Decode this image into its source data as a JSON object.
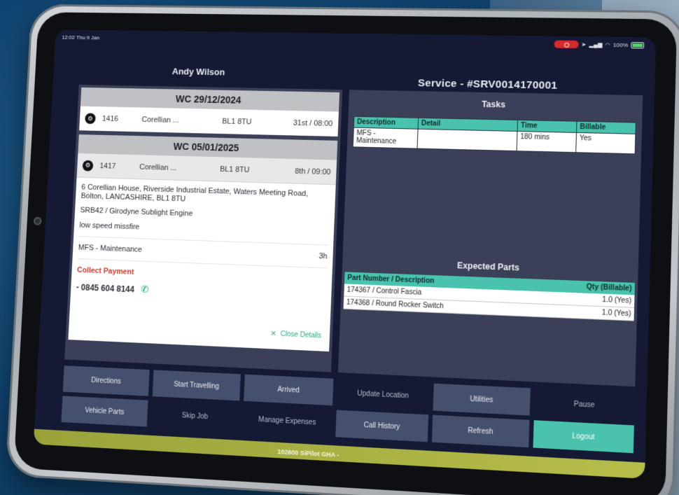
{
  "status_bar": {
    "time": "12:02  Thu 9 Jan",
    "battery": "100%"
  },
  "header": {
    "tech_name": "Andy Wilson",
    "service_title": "Service - #SRV0014170001"
  },
  "weeks": [
    {
      "label": "WC 29/12/2024",
      "jobs": [
        {
          "id": "1416",
          "site": "Corellian ...",
          "postcode": "BL1 8TU",
          "time": "31st / 08:00"
        }
      ]
    },
    {
      "label": "WC 05/01/2025",
      "jobs": [
        {
          "id": "1417",
          "site": "Corellian ...",
          "postcode": "BL1 8TU",
          "time": "8th / 09:00"
        }
      ]
    }
  ],
  "job_details": {
    "address": "6 Corellian House, Riverside Industrial Estate, Waters Meeting Road, Bolton, LANCASHIRE, BL1 8TU",
    "asset": "SRB42 / Girodyne Sublight Engine",
    "fault": "low speed missfire",
    "task": "MFS - Maintenance",
    "task_duration": "3h",
    "collect_payment": "Collect Payment",
    "phone": "- 0845 604 8144",
    "close_label": "Close Details"
  },
  "tasks": {
    "title": "Tasks",
    "columns": [
      "Description",
      "Detail",
      "Time",
      "Billable"
    ],
    "rows": [
      {
        "description": "MFS - Maintenance",
        "detail": "",
        "time": "180 mins",
        "billable": "Yes"
      }
    ]
  },
  "parts": {
    "title": "Expected Parts",
    "columns": [
      "Part Number / Description",
      "Qty (Billable)"
    ],
    "rows": [
      {
        "part": "174367 / Control Fascia",
        "qty": "1.0 (Yes)"
      },
      {
        "part": "174368 / Round Rocker Switch",
        "qty": "1.0 (Yes)"
      }
    ]
  },
  "buttons": {
    "directions": "Directions",
    "start_travelling": "Start Travelling",
    "arrived": "Arrived",
    "update_location": "Update Location",
    "utilities": "Utilities",
    "pause": "Pause",
    "vehicle_parts": "Vehicle Parts",
    "skip_job": "Skip Job",
    "manage_expenses": "Manage Expenses",
    "call_history": "Call History",
    "refresh": "Refresh",
    "logout": "Logout"
  },
  "footer": {
    "label": "102600 SiPilot GHA -"
  },
  "colors": {
    "accent": "#49c3ad",
    "screen_bg": "#141a33",
    "panel_bg": "#3a4057",
    "alert_red": "#c33a2c",
    "footer_olive": "#b6bd4b"
  }
}
